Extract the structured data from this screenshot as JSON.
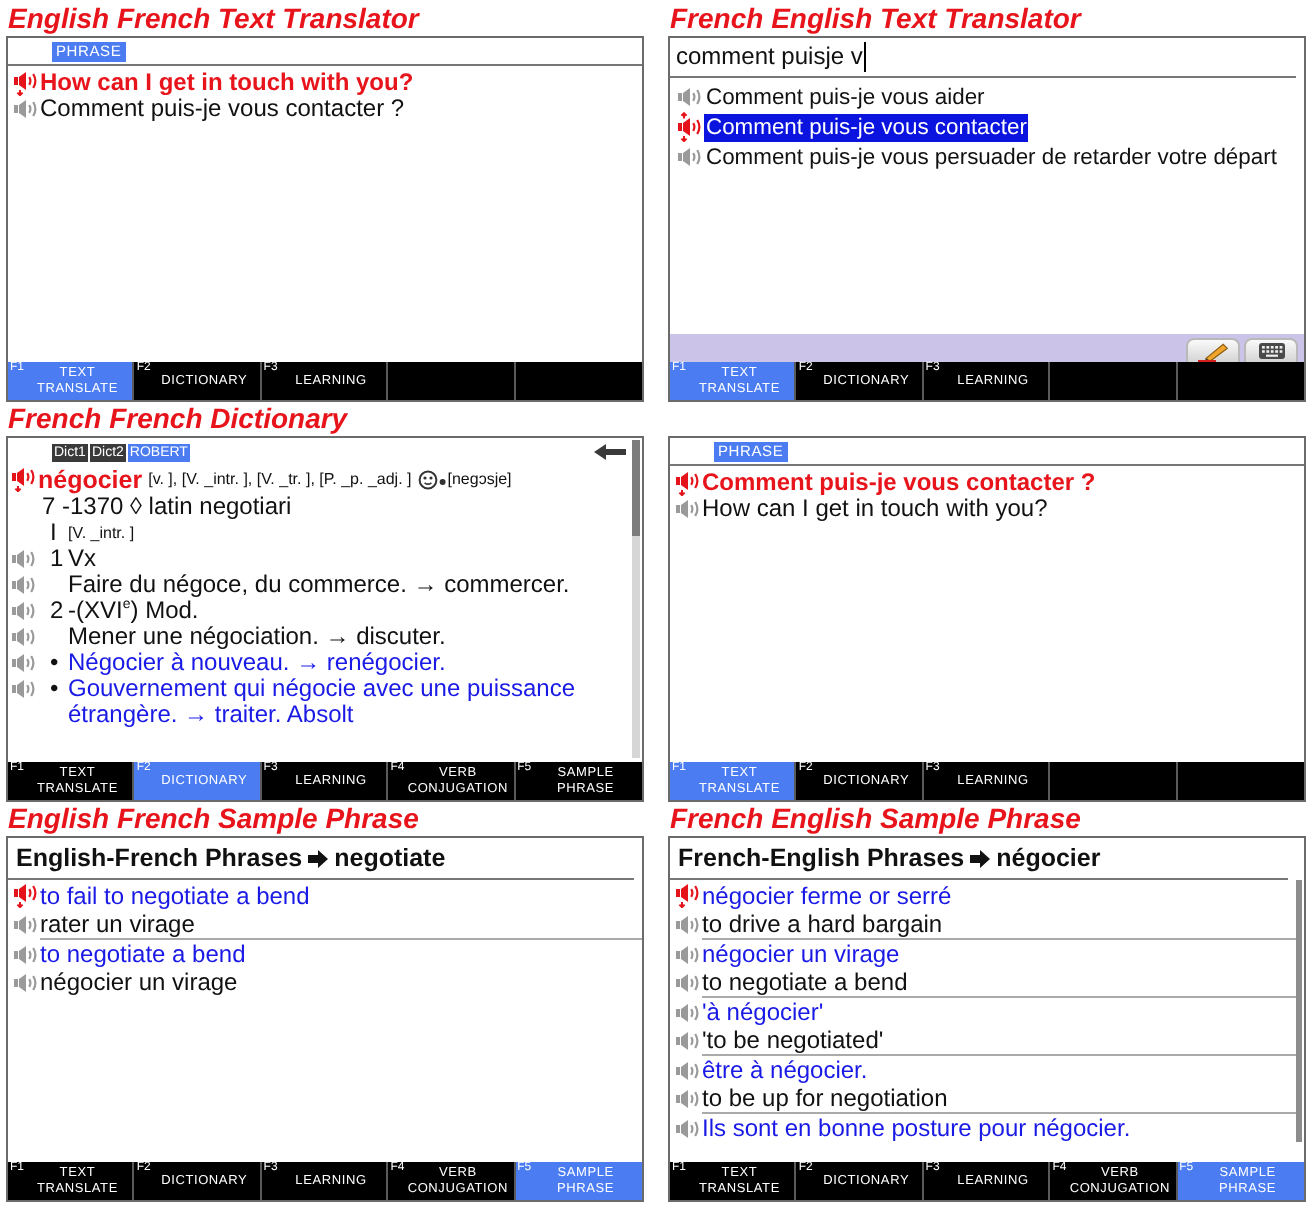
{
  "panels": [
    {
      "heading": "English French Text Translator",
      "kind": "phrase",
      "tag": "PHRASE",
      "lines": [
        {
          "kind": "source",
          "text": "How can I get in touch with you?",
          "selected": true
        },
        {
          "kind": "target",
          "text": "Comment puis-je vous contacter ?",
          "selected": false
        }
      ],
      "softkeys": [
        {
          "fkey": "F1",
          "label": "TEXT TRANSLATE",
          "selected": true
        },
        {
          "fkey": "F2",
          "label": "DICTIONARY",
          "selected": false
        },
        {
          "fkey": "F3",
          "label": "LEARNING",
          "selected": false
        }
      ]
    },
    {
      "heading": "French English Text Translator",
      "kind": "suggest",
      "input": {
        "value": "comment puisje v"
      },
      "suggestions": [
        {
          "text": "Comment puis-je vous aider",
          "selected": false
        },
        {
          "text": "Comment puis-je vous contacter",
          "selected": true
        },
        {
          "text": "Comment puis-je vous persuader de retarder votre départ",
          "selected": false
        }
      ],
      "softkeys": [
        {
          "fkey": "F1",
          "label": "TEXT TRANSLATE",
          "selected": true
        },
        {
          "fkey": "F2",
          "label": "DICTIONARY",
          "selected": false
        },
        {
          "fkey": "F3",
          "label": "LEARNING",
          "selected": false
        }
      ]
    },
    {
      "heading": "French French Dictionary",
      "kind": "dictionary",
      "dict_tabs": [
        {
          "label": "Dict1",
          "selected": false
        },
        {
          "label": "Dict2",
          "selected": false
        },
        {
          "label": "ROBERT",
          "selected": true
        }
      ],
      "entry": {
        "headword": "négocier",
        "grammar": "[v. ], [V. _intr. ], [V. _tr. ], [P. _p. _adj. ]",
        "pronunciation": "[negɔsje]",
        "selected": true
      },
      "lines": [
        {
          "kind": "note",
          "text": "7 -1370 ◊ latin negotiari"
        },
        {
          "kind": "grammar",
          "marker": "I",
          "text": "[V. _intr. ]"
        },
        {
          "kind": "sense",
          "marker": "1",
          "text": "Vx",
          "selected": false
        },
        {
          "kind": "sense",
          "text": "Faire du négoce, du commerce. → commercer.",
          "selected": false
        },
        {
          "kind": "sense",
          "marker": "2",
          "text": "-(XVI$^{e}$) Mod.",
          "selected": false
        },
        {
          "kind": "sense",
          "text": "Mener une négociation. → discuter.",
          "selected": false
        },
        {
          "kind": "example",
          "marker": "•",
          "text": "Négocier à nouveau. → renégocier.",
          "selected": false
        },
        {
          "kind": "example",
          "marker": "•",
          "text": "Gouvernement qui négocie avec une puissance étrangère. → traiter. Absolt",
          "selected": false
        }
      ],
      "scrollbar": true,
      "softkeys": [
        {
          "fkey": "F1",
          "label": "TEXT TRANSLATE",
          "selected": false
        },
        {
          "fkey": "F2",
          "label": "DICTIONARY",
          "selected": true
        },
        {
          "fkey": "F3",
          "label": "LEARNING",
          "selected": false
        },
        {
          "fkey": "F4",
          "label": "VERB CONJUGATION",
          "selected": false
        },
        {
          "fkey": "F5",
          "label": "SAMPLE PHRASE",
          "selected": false
        }
      ]
    },
    {
      "kind": "phrase",
      "tag": "PHRASE",
      "lines": [
        {
          "kind": "source",
          "text": "Comment puis-je vous contacter ?",
          "selected": true
        },
        {
          "kind": "target",
          "text": "How can I get in touch with you?",
          "selected": false
        }
      ],
      "softkeys": [
        {
          "fkey": "F1",
          "label": "TEXT TRANSLATE",
          "selected": true
        },
        {
          "fkey": "F2",
          "label": "DICTIONARY",
          "selected": false
        },
        {
          "fkey": "F3",
          "label": "LEARNING",
          "selected": false
        }
      ]
    },
    {
      "heading": "English French Sample Phrase",
      "kind": "phrasebook",
      "title": "English-French Phrases",
      "query": "negotiate",
      "scrollbar": false,
      "pairs": [
        {
          "source": "to fail to negotiate a bend",
          "target": "rater un virage",
          "selected": true
        },
        {
          "source": "to negotiate a bend",
          "target": "négocier un virage",
          "selected": false
        }
      ],
      "softkeys": [
        {
          "fkey": "F1",
          "label": "TEXT TRANSLATE",
          "selected": false
        },
        {
          "fkey": "F2",
          "label": "DICTIONARY",
          "selected": false
        },
        {
          "fkey": "F3",
          "label": "LEARNING",
          "selected": false
        },
        {
          "fkey": "F4",
          "label": "VERB CONJUGATION",
          "selected": false
        },
        {
          "fkey": "F5",
          "label": "SAMPLE PHRASE",
          "selected": true
        }
      ]
    },
    {
      "heading": "French English Sample Phrase",
      "kind": "phrasebook",
      "title": "French-English Phrases",
      "query": "négocier",
      "scrollbar": true,
      "pairs": [
        {
          "source": "négocier ferme or serré",
          "target": "to drive a hard bargain",
          "selected": true
        },
        {
          "source": "négocier un virage",
          "target": "to negotiate a bend",
          "selected": false
        },
        {
          "source": "'à négocier'",
          "target": "'to be negotiated'",
          "selected": false
        },
        {
          "source": "être à négocier.",
          "target": "to be up for negotiation",
          "selected": false
        },
        {
          "source": "Ils sont en bonne posture pour négocier.",
          "selected": false
        }
      ],
      "softkeys": [
        {
          "fkey": "F1",
          "label": "TEXT TRANSLATE",
          "selected": false
        },
        {
          "fkey": "F2",
          "label": "DICTIONARY",
          "selected": false
        },
        {
          "fkey": "F3",
          "label": "LEARNING",
          "selected": false
        },
        {
          "fkey": "F4",
          "label": "VERB CONJUGATION",
          "selected": false
        },
        {
          "fkey": "F5",
          "label": "SAMPLE PHRASE",
          "selected": true
        }
      ]
    }
  ]
}
